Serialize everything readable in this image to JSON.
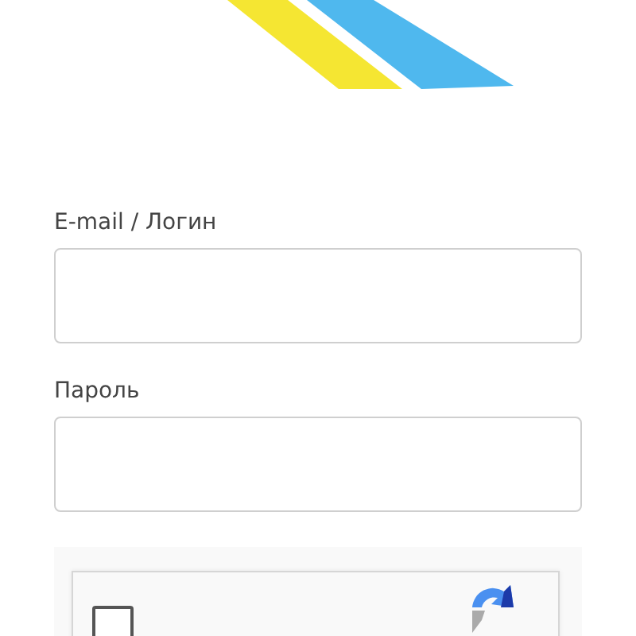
{
  "fields": [
    {
      "label": "E-mail / Логин"
    },
    {
      "label": "Пароль"
    }
  ],
  "captcha": {
    "checked": false
  }
}
